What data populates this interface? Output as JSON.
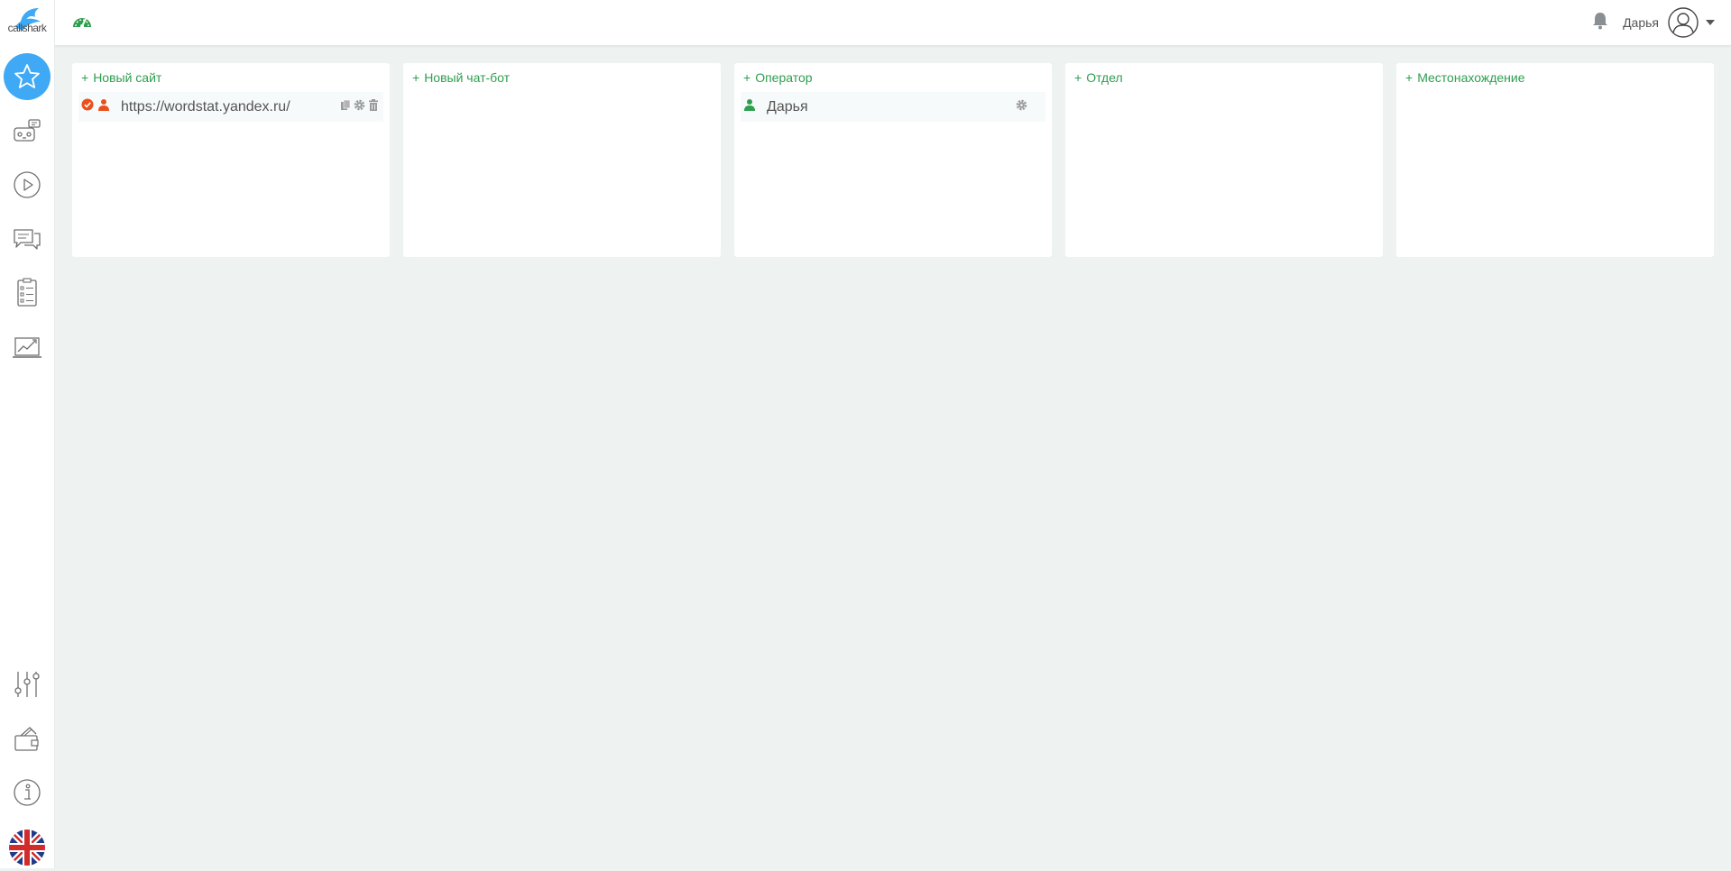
{
  "app": {
    "logo_text": "callshark",
    "colors": {
      "accent": "#2e9e4f",
      "active_nav": "#3fa9f5",
      "alert": "#e9501e",
      "icon_gray": "#8a8a8a"
    }
  },
  "header": {
    "dashboard_icon": "speedometer-icon",
    "notification_icon": "bell-icon",
    "user_name": "Дарья",
    "avatar_icon": "user-circle-icon",
    "dropdown_icon": "caret-down-icon"
  },
  "sidebar": {
    "top_items": [
      {
        "icon": "star-icon",
        "active": true
      },
      {
        "icon": "robot-chat-icon",
        "active": false
      },
      {
        "icon": "play-circle-icon",
        "active": false
      },
      {
        "icon": "chat-bubbles-icon",
        "active": false
      },
      {
        "icon": "checklist-icon",
        "active": false
      },
      {
        "icon": "chart-monitor-icon",
        "active": false
      }
    ],
    "bottom_items": [
      {
        "icon": "sliders-icon"
      },
      {
        "icon": "wallet-icon"
      },
      {
        "icon": "info-icon"
      },
      {
        "icon": "uk-flag-icon"
      }
    ]
  },
  "panels": {
    "sites": {
      "plus": "+",
      "header": "Новый сайт",
      "rows": [
        {
          "label": "https://wordstat.yandex.ru/",
          "status_icon": "check-circle-icon",
          "user_icon": "user-icon",
          "actions": [
            "copy-icon",
            "gear-icon",
            "trash-icon"
          ]
        }
      ]
    },
    "chatbots": {
      "plus": "+",
      "header": "Новый чат-бот",
      "rows": []
    },
    "operators": {
      "plus": "+",
      "header": "Оператор",
      "rows": [
        {
          "label": "Дарья",
          "user_icon": "user-icon",
          "actions": [
            "gear-icon"
          ]
        }
      ]
    },
    "departments": {
      "plus": "+",
      "header": "Отдел",
      "rows": []
    },
    "locations": {
      "plus": "+",
      "header": "Местонахождение",
      "rows": []
    }
  }
}
